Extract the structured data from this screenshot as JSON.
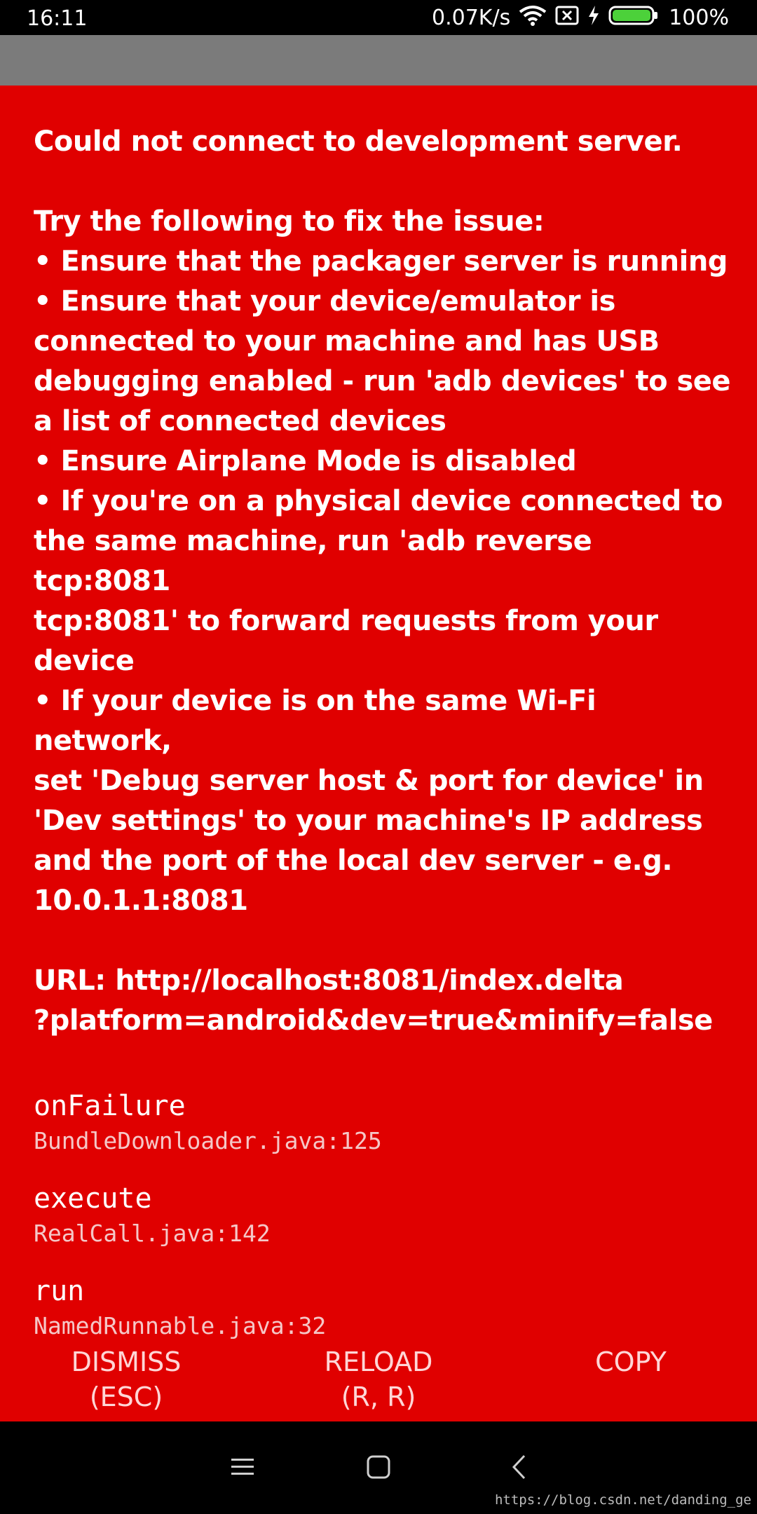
{
  "status_bar": {
    "time": "16:11",
    "network_speed": "0.07K/s",
    "battery_percent": "100%",
    "icons": [
      "wifi-icon",
      "sim-missing-icon",
      "charging-icon",
      "battery-icon"
    ]
  },
  "error": {
    "message": "Could not connect to development server.\n\nTry the following to fix the issue:\n• Ensure that the packager server is running\n• Ensure that your device/emulator is\nconnected to your machine and has USB\ndebugging enabled - run 'adb devices' to see\na list of connected devices\n• Ensure Airplane Mode is disabled\n• If you're on a physical device connected to\nthe same machine, run 'adb reverse tcp:8081\ntcp:8081' to forward requests from your\ndevice\n• If your device is on the same Wi-Fi network,\nset 'Debug server host & port for device' in\n'Dev settings' to your machine's IP address\nand the port of the local dev server - e.g.\n10.0.1.1:8081\n\nURL: http://localhost:8081/index.delta\n?platform=android&dev=true&minify=false",
    "stack": [
      {
        "method": "onFailure",
        "file": "BundleDownloader.java:125"
      },
      {
        "method": "execute",
        "file": "RealCall.java:142"
      },
      {
        "method": "run",
        "file": "NamedRunnable.java:32"
      }
    ]
  },
  "buttons": {
    "dismiss": "DISMISS\n(ESC)",
    "reload": "RELOAD\n(R, R)",
    "copy": "COPY"
  },
  "nav": {
    "icons": [
      "menu-icon",
      "home-icon",
      "back-icon"
    ]
  },
  "watermark": "https://blog.csdn.net/danding_ge",
  "colors": {
    "background": "#e00000",
    "app_bar": "#7b7b7b",
    "button_text": "#ffd6d6",
    "file_text": "#f5c7c7"
  }
}
